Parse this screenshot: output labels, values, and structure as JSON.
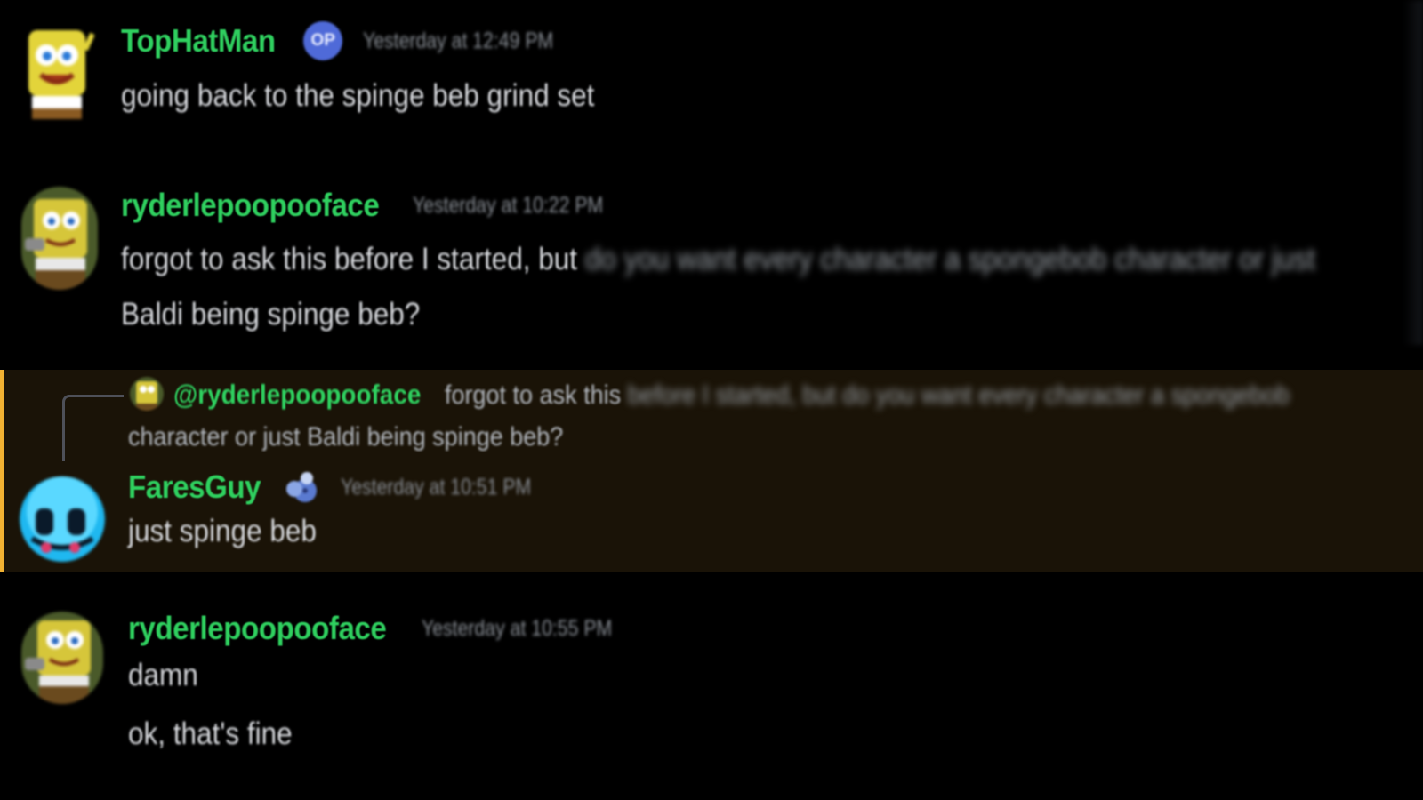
{
  "colors": {
    "background": "#000000",
    "username": "#2fd05f",
    "timestamp": "#8a8f96",
    "message_text": "#d8dade",
    "highlight_bg": "#1a1307",
    "highlight_bar": "#f0b132",
    "op_badge": "#4f6ad8"
  },
  "messages": [
    {
      "username": "TopHatMan",
      "badge": "OP",
      "timestamp": "Yesterday at 12:49 PM",
      "lines": [
        "going back to the spinge beb grind set"
      ],
      "avatar_icon": "spongebob-avatar-icon"
    },
    {
      "username": "ryderlepoopooface",
      "timestamp": "Yesterday at 10:22 PM",
      "line1_clear": "forgot to ask this before I started, but",
      "line1_blurred": " do you want every character a spongebob character or just",
      "line2": "Baldi being spinge beb?",
      "avatar_icon": "spongebob-avatar-icon"
    },
    {
      "reply": {
        "mention": "@ryderlepoopooface",
        "text_clear": "forgot to ask this",
        "text_blurred": " before I started, but do you want every character a spongebob",
        "text_line2": "character or just Baldi being spinge beb?"
      },
      "username": "FaresGuy",
      "role_icon": "blueberry-role-icon",
      "timestamp": "Yesterday at 10:51 PM",
      "lines": [
        "just spinge beb"
      ],
      "avatar_icon": "blue-face-avatar-icon"
    },
    {
      "username": "ryderlepoopooface",
      "timestamp": "Yesterday at 10:55 PM",
      "lines": [
        "damn",
        "ok, that's fine"
      ],
      "avatar_icon": "spongebob-avatar-icon"
    }
  ]
}
